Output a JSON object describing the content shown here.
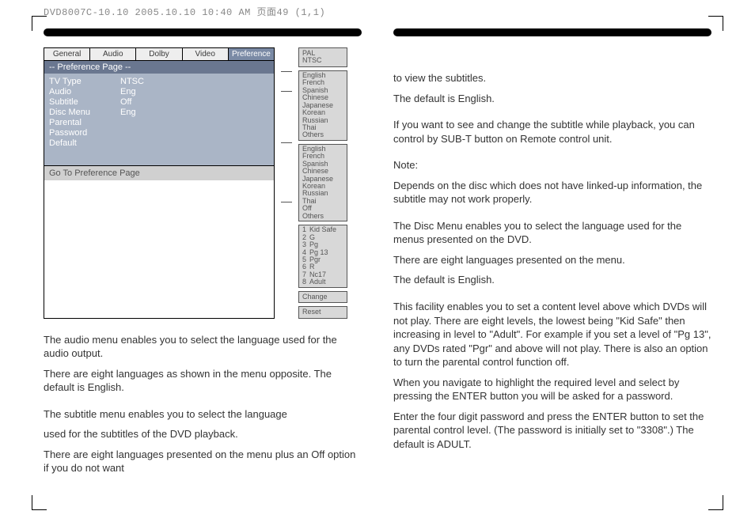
{
  "header_strip": "DVD8007C-10.10  2005.10.10 10:40 AM  页面49 (1,1)",
  "osd": {
    "tabs": [
      "General",
      "Audio",
      "Dolby",
      "Video",
      "Preference"
    ],
    "active_tab_index": 4,
    "title": "-- Preference Page --",
    "rows": [
      {
        "label": "TV Type",
        "value": "NTSC"
      },
      {
        "label": "Audio",
        "value": "Eng"
      },
      {
        "label": "Subtitle",
        "value": "Off"
      },
      {
        "label": "Disc Menu",
        "value": "Eng"
      },
      {
        "label": "Parental",
        "value": ""
      },
      {
        "label": "Password",
        "value": ""
      },
      {
        "label": "Default",
        "value": ""
      }
    ],
    "hint": "Go To Preference Page"
  },
  "side": {
    "tvtype": [
      "PAL",
      "NTSC"
    ],
    "audio_langs": [
      "English",
      "French",
      "Spanish",
      "Chinese",
      "Japanese",
      "Korean",
      "Russian",
      "Thai",
      "Others"
    ],
    "subtitle_langs": [
      "English",
      "French",
      "Spanish",
      "Chinese",
      "Japanese",
      "Korean",
      "Russian",
      "Thai",
      "Off",
      "Others"
    ],
    "ratings": [
      {
        "n": "1",
        "label": "Kid Safe"
      },
      {
        "n": "2",
        "label": "G"
      },
      {
        "n": "3",
        "label": "Pg"
      },
      {
        "n": "4",
        "label": "Pg 13"
      },
      {
        "n": "5",
        "label": "Pgr"
      },
      {
        "n": "6",
        "label": "R"
      },
      {
        "n": "7",
        "label": "Nc17"
      },
      {
        "n": "8",
        "label": "Adult"
      }
    ],
    "password_btn": "Change",
    "default_btn": "Reset"
  },
  "left_text": {
    "p1": "The audio menu enables you to select the language used for the audio output.",
    "p2": "There are eight languages as shown in the menu opposite. The default is English.",
    "p3": "The subtitle menu enables you to select the language",
    "p4": "used for the subtitles of the DVD playback.",
    "p5": "There are eight languages presented on the menu plus an Off option if you do not want"
  },
  "right_text": {
    "p1": "to view the subtitles.",
    "p2": "The default is English.",
    "p3": "If you want to see and change the subtitle while playback, you can control by SUB-T button on Remote control unit.",
    "p4": "Note:",
    "p5": "Depends on the disc which does not have linked-up information, the subtitle may not work properly.",
    "p6": "The Disc Menu enables you to select the language used for the menus presented on the DVD.",
    "p7": "There are eight languages presented on the menu.",
    "p8": "The default is English.",
    "p9": "This facility enables you to set a content level above which DVDs will not play. There are eight levels, the lowest being \"Kid Safe\" then increasing in level to \"Adult\". For example if you set a level of \"Pg 13\", any DVDs rated \"Pgr\" and above will not play. There is also an option to turn the parental control function off.",
    "p10": "When you navigate to highlight the required level and select by pressing the ENTER button you will be asked for a password.",
    "p11": "Enter the four digit password and press the ENTER button to set the parental control level. (The password is initially set to \"3308\".) The default is ADULT."
  }
}
